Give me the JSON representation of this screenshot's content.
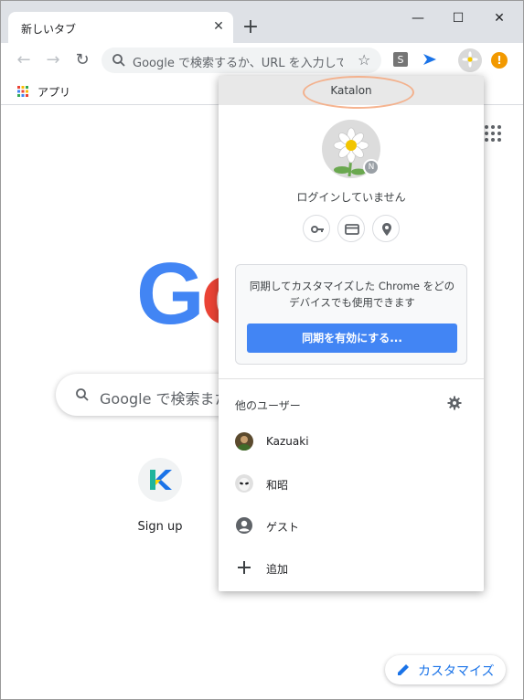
{
  "tab": {
    "title": "新しいタブ",
    "close": "✕",
    "new_tab": "+"
  },
  "window": {
    "minimize": "—",
    "maximize": "☐",
    "close": "✕"
  },
  "toolbar": {
    "back": "←",
    "forward": "→",
    "reload": "↻",
    "omnibox_placeholder": "Google で検索するか、URL を入力して...",
    "star": "☆",
    "alert": "!"
  },
  "bookmarks": {
    "apps_label": "アプリ"
  },
  "ntp": {
    "logo_letters": [
      "G",
      "o"
    ],
    "logo_colors": [
      "#4285f4",
      "#ea4335"
    ],
    "search_placeholder": "Google で検索また",
    "shortcut_label": "Sign up",
    "customize_label": "カスタマイズ"
  },
  "popup": {
    "profile_name": "Katalon",
    "login_status": "ログインしていません",
    "sync_badge": "N",
    "sync_description": "同期してカスタマイズした Chrome をどのデバイスでも使用できます",
    "sync_button": "同期を有効にする...",
    "others_label": "他のユーザー",
    "users": [
      {
        "label": "Kazuaki",
        "icon": "kazuaki-avatar-icon"
      },
      {
        "label": "和昭",
        "icon": "alien-avatar-icon"
      },
      {
        "label": "ゲスト",
        "icon": "guest-person-icon"
      },
      {
        "label": "追加",
        "icon": "plus-icon"
      }
    ]
  },
  "colors": {
    "accent": "#1a73e8",
    "sync_button": "#4285f4",
    "highlight": "#f4a77d"
  }
}
